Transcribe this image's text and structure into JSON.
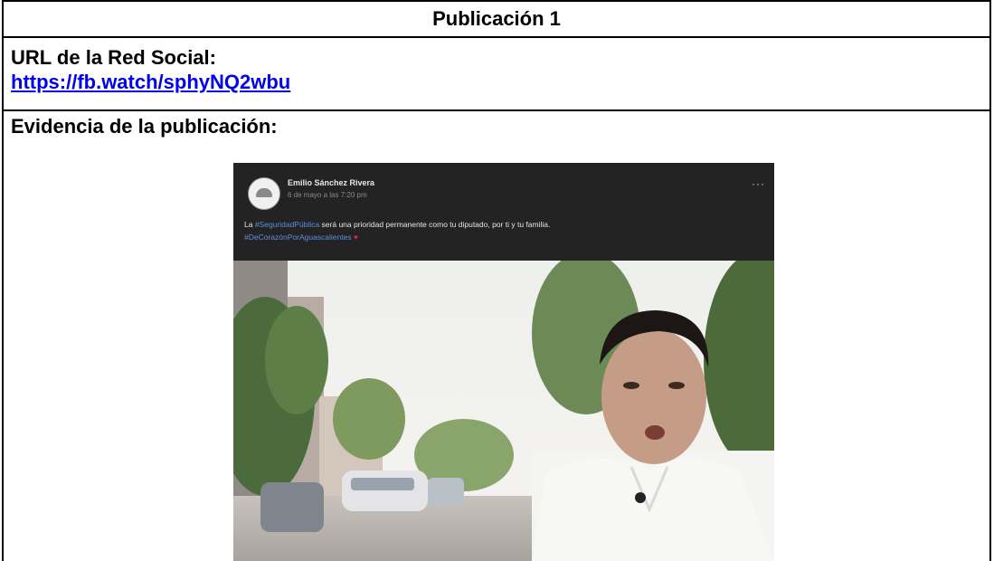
{
  "header": {
    "title": "Publicación 1"
  },
  "url": {
    "label": "URL de la Red Social:",
    "link": "https://fb.watch/sphyNQ2wbu"
  },
  "evidence": {
    "label": "Evidencia de la publicación:"
  },
  "post": {
    "author": "Emilio Sánchez Rivera",
    "date": "6 de mayo a las 7:20 pm",
    "text_prefix": "La ",
    "hashtag1": "#SeguridadPública",
    "text_body": " será una prioridad permanente como tu diputado, por ti y tu familia.",
    "hashtag2": "#DeCorazónPorAguascalientes",
    "heart": "♥",
    "more": "···"
  }
}
